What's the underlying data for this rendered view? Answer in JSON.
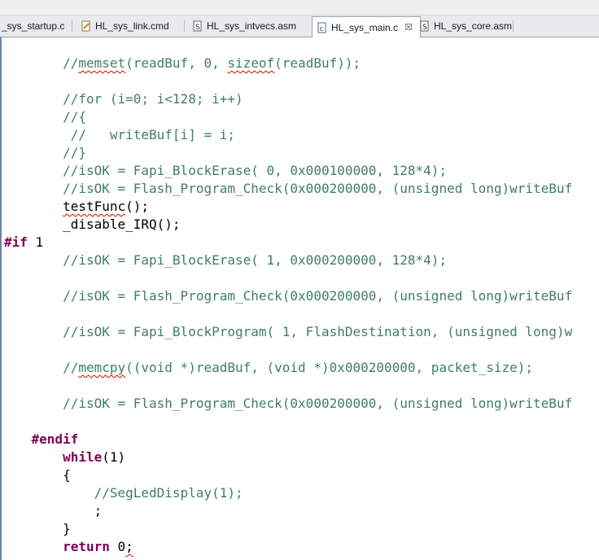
{
  "tabs": [
    {
      "label": "_sys_startup.c",
      "icon": "c-file-icon"
    },
    {
      "label": "HL_sys_link.cmd",
      "icon": "cmd-file-icon"
    },
    {
      "label": "HL_sys_intvecs.asm",
      "icon": "asm-file-icon"
    },
    {
      "label": "HL_sys_main.c",
      "icon": "c-file-icon",
      "active": true,
      "close": "☒"
    },
    {
      "label": "HL_sys_core.asm",
      "icon": "asm-file-icon"
    }
  ],
  "code": {
    "l1a": "        //",
    "l1b": "memset",
    "l1c": "(readBuf, 0, ",
    "l1d": "sizeof",
    "l1e": "(readBuf));",
    "l2": "        //for (i=0; i<128; i++)",
    "l3": "        //{",
    "l4": "         //   writeBuf[i] = i;",
    "l5": "        //}",
    "l6": "        //isOK = Fapi_BlockErase( 0, 0x000100000, 128*4);",
    "l7": "        //isOK = Flash_Program_Check(0x000200000, (unsigned long)writeBuf",
    "l8a": "        ",
    "l8b": "testFunc",
    "l8c": "();",
    "l9": "        _disable_IRQ();",
    "l10a": "#if",
    "l10b": " 1",
    "l11": "        //isOK = Fapi_BlockErase( 1, 0x000200000, 128*4);",
    "l12": "        //isOK = Flash_Program_Check(0x000200000, (unsigned long)writeBuf",
    "l13": "        //isOK = Fapi_BlockProgram( 1, FlashDestination, (unsigned long)w",
    "l14a": "        //",
    "l14b": "memcpy",
    "l14c": "((void *)readBuf, (void *)0x000200000, packet_size);",
    "l15": "        //isOK = Flash_Program_Check(0x000200000, (unsigned long)writeBuf",
    "l16a": "    ",
    "l16b": "#endif",
    "l17a": "        ",
    "l17b": "while",
    "l17c": "(1)",
    "l18": "        {",
    "l19": "            //SegLedDisplay(1);",
    "l20": "            ;",
    "l21": "        }",
    "l22a": "        ",
    "l22b": "return",
    "l22c": " 0",
    "l22d": ";"
  },
  "colors": {
    "comment": "#3f7f5f",
    "keyword": "#7f0055",
    "text": "#000000"
  }
}
